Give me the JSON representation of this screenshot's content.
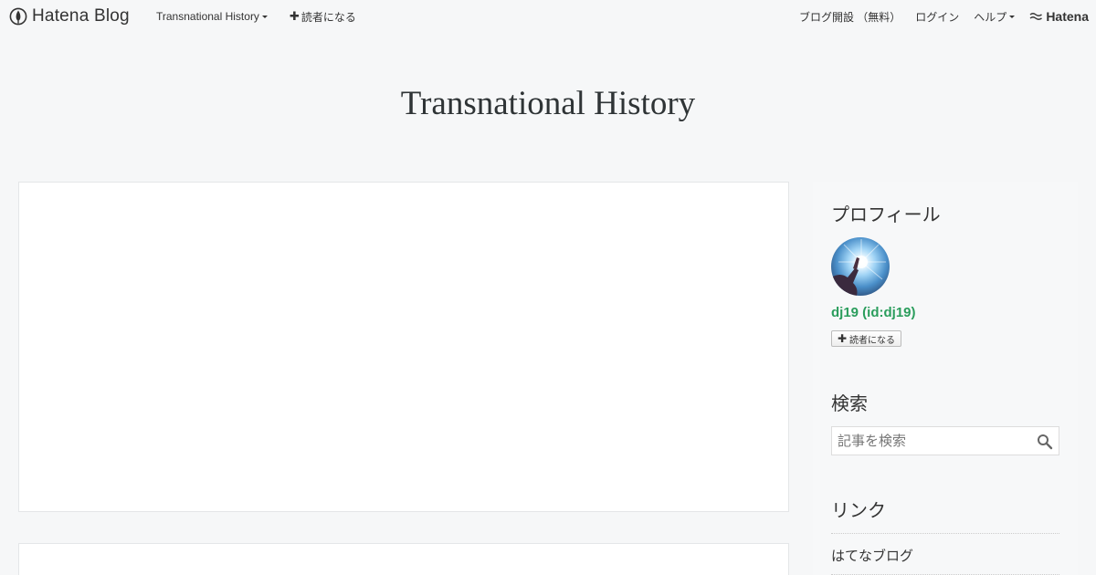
{
  "global_header": {
    "logo_text": "Hatena Blog",
    "blog_menu_label": "Transnational History",
    "subscribe_label": "読者になる",
    "open_blog_label": "ブログ開設 （無料）",
    "login_label": "ログイン",
    "help_label": "ヘルプ",
    "hatena_label": "Hatena"
  },
  "blog": {
    "title": "Transnational History"
  },
  "sidebar": {
    "profile": {
      "title": "プロフィール",
      "name": "dj19 (id:dj19)",
      "follow_label": "読者になる"
    },
    "search": {
      "title": "検索",
      "placeholder": "記事を検索"
    },
    "links": {
      "title": "リンク",
      "items": [
        "はてなブログ"
      ]
    }
  },
  "colors": {
    "page_bg": "#f6f7f8",
    "profile_name": "#2a9d5c",
    "card_bg": "#ffffff"
  }
}
